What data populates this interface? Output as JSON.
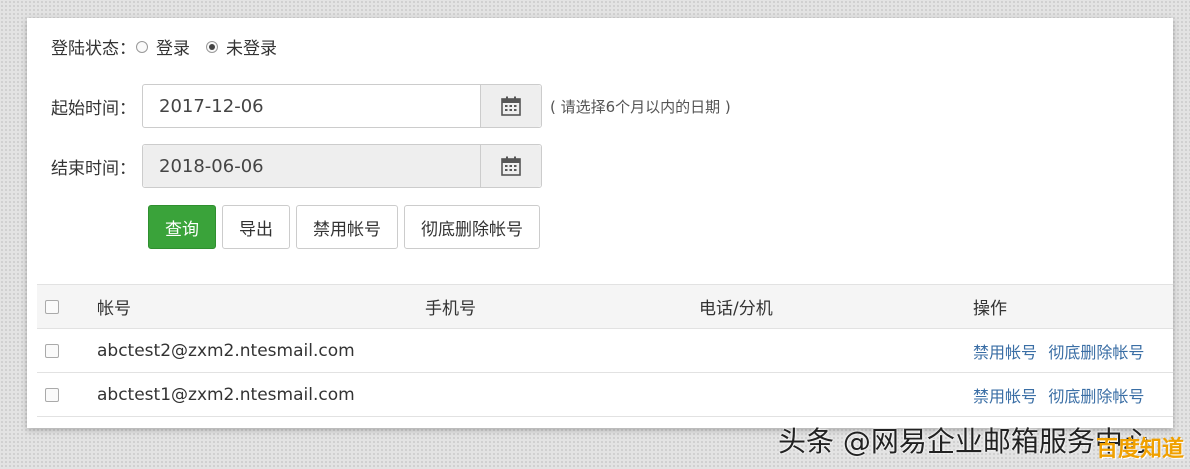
{
  "filters": {
    "login_status_label": "登陆状态：",
    "radio_logged_in": "登录",
    "radio_not_logged_in": "未登录",
    "start_label": "起始时间：",
    "start_value": "2017-12-06",
    "end_label": "结束时间：",
    "end_value": "2018-06-06",
    "hint": "( 请选择6个月以内的日期 )"
  },
  "actions": {
    "query": "查询",
    "export": "导出",
    "disable": "禁用帐号",
    "delete": "彻底删除帐号"
  },
  "table": {
    "headers": [
      "帐号",
      "手机号",
      "电话/分机",
      "操作"
    ],
    "rows": [
      {
        "account": "abctest2@zxm2.ntesmail.com",
        "phone": "",
        "tel": "",
        "op_disable": "禁用帐号",
        "op_delete": "彻底删除帐号"
      },
      {
        "account": "abctest1@zxm2.ntesmail.com",
        "phone": "",
        "tel": "",
        "op_disable": "禁用帐号",
        "op_delete": "彻底删除帐号"
      }
    ]
  },
  "watermark": {
    "main": "头条 @网易企业邮箱服务中心",
    "corner": "百度知道"
  },
  "colors": {
    "primary_button": "#3aa33a",
    "link": "#3a6ea5"
  }
}
